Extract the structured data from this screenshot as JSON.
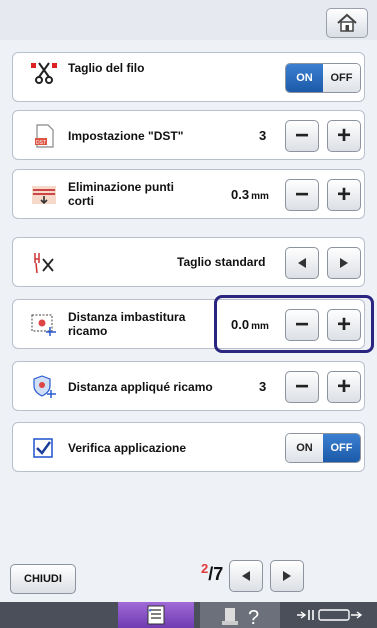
{
  "header": {
    "home_icon": "home-icon"
  },
  "rows": {
    "thread_cut": {
      "label": "Taglio del filo",
      "on_label": "ON",
      "off_label": "OFF",
      "state": "ON"
    },
    "dst": {
      "label": "Impostazione \"DST\"",
      "value": "3"
    },
    "short_stitch": {
      "label_line1": "Eliminazione punti",
      "label_line2": "corti",
      "value": "0.3",
      "unit": "mm"
    },
    "cut_mode": {
      "value": "Taglio standard"
    },
    "baste_distance": {
      "label_line1": "Distanza imbastitura",
      "label_line2": "ricamo",
      "value": "0.0",
      "unit": "mm"
    },
    "applique_distance": {
      "label": "Distanza appliqué ricamo",
      "value": "3"
    },
    "verify": {
      "label": "Verifica applicazione",
      "on_label": "ON",
      "off_label": "OFF",
      "state": "OFF",
      "checked": true
    }
  },
  "footer": {
    "close_label": "CHIUDI",
    "page_current": "2",
    "page_separator": "/",
    "page_total": "7"
  },
  "colors": {
    "accent": "#1b5aa8",
    "highlight": "#2a2580",
    "page_current": "#e23a3a",
    "active_tab": "#8a4fc9"
  }
}
